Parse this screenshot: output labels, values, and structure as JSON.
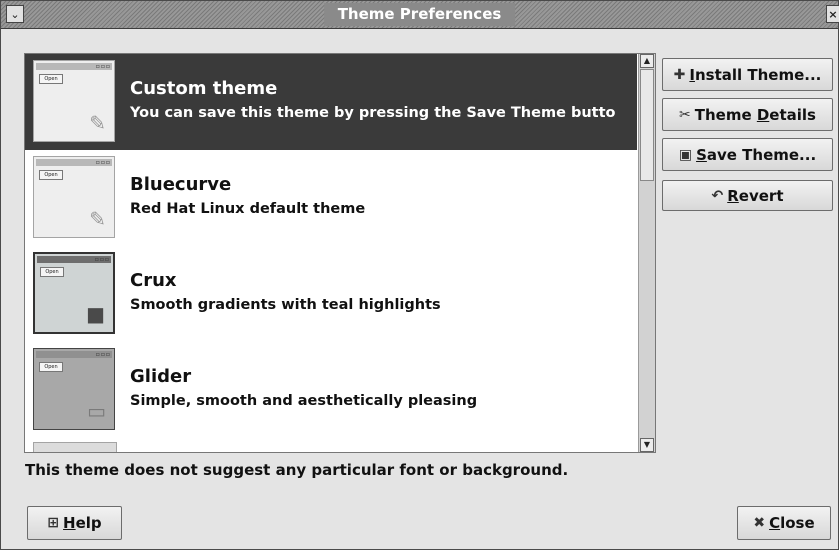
{
  "window": {
    "title": "Theme Preferences",
    "menu_glyph": "⌄",
    "close_glyph": "×"
  },
  "themes": [
    {
      "name": "Custom theme",
      "description": "You can save this theme by pressing the Save Theme butto",
      "selected": true,
      "thumb_open": "Open"
    },
    {
      "name": "Bluecurve",
      "description": "Red Hat Linux default theme",
      "selected": false,
      "thumb_open": "Open"
    },
    {
      "name": "Crux",
      "description": "Smooth gradients with teal highlights",
      "selected": false,
      "thumb_open": "Open"
    },
    {
      "name": "Glider",
      "description": "Simple, smooth and aesthetically pleasing",
      "selected": false,
      "thumb_open": "Open"
    }
  ],
  "buttons": {
    "install": {
      "pre": "",
      "key": "I",
      "post": "nstall Theme...",
      "icon": "✚"
    },
    "details": {
      "pre": "Theme ",
      "key": "D",
      "post": "etails",
      "icon": "✂"
    },
    "save": {
      "pre": "",
      "key": "S",
      "post": "ave Theme...",
      "icon": "▣"
    },
    "revert": {
      "pre": "",
      "key": "R",
      "post": "evert",
      "icon": "↶"
    },
    "help": {
      "pre": "",
      "key": "H",
      "post": "elp",
      "icon": "⊞"
    },
    "close": {
      "pre": "",
      "key": "C",
      "post": "lose",
      "icon": "✖"
    }
  },
  "status_text": "This theme does not suggest any particular font or background.",
  "scrollbar": {
    "up_glyph": "▲",
    "down_glyph": "▼"
  },
  "colors": {
    "selection": "#3a3a3a",
    "window_bg": "#e4e4e4"
  }
}
